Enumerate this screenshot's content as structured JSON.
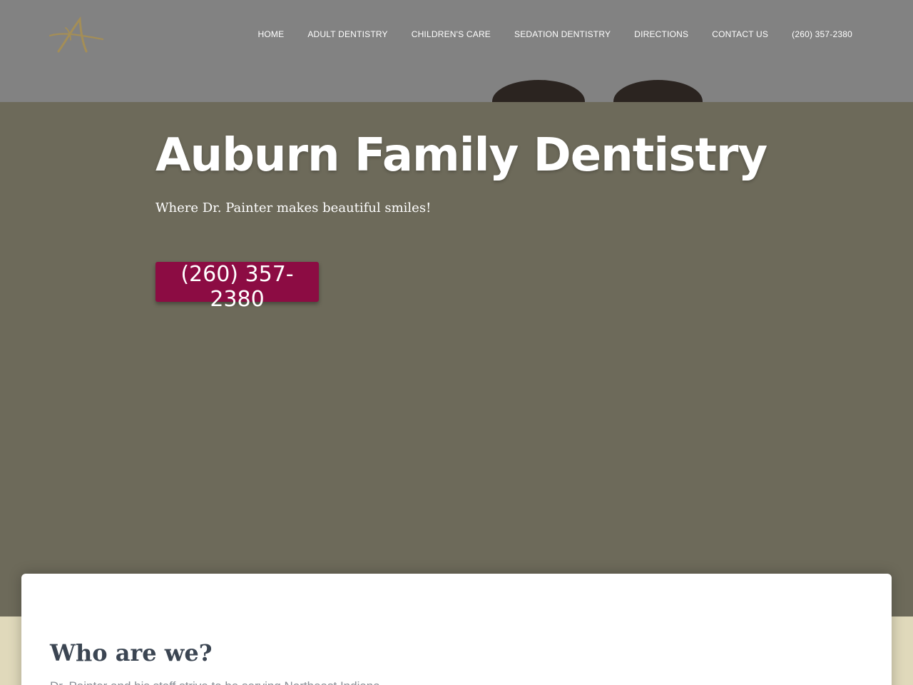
{
  "brand": {
    "logo_icon": "script-a-logo-icon",
    "logo_color": "#a48e57"
  },
  "nav": {
    "items": [
      {
        "label": "HOME"
      },
      {
        "label": "ADULT DENTISTRY"
      },
      {
        "label": "CHILDREN'S CARE"
      },
      {
        "label": "SEDATION DENTISTRY"
      },
      {
        "label": "DIRECTIONS"
      },
      {
        "label": "CONTACT US"
      },
      {
        "label": "(260) 357-2380"
      }
    ]
  },
  "hero": {
    "title": "Auburn Family Dentistry",
    "subtitle": "Where Dr. Painter makes beautiful smiles!",
    "cta_label": "(260) 357-2380",
    "cta_color": "#8c0c43"
  },
  "about": {
    "title": "Who are we?",
    "text": "Dr. Painter and his staff strive to be serving Northeast Indiana"
  },
  "colors": {
    "nav_bg": "#828282",
    "hero_bg": "#6d6a5a",
    "page_bg": "#e0d9bb",
    "heading": "#3b4552"
  }
}
